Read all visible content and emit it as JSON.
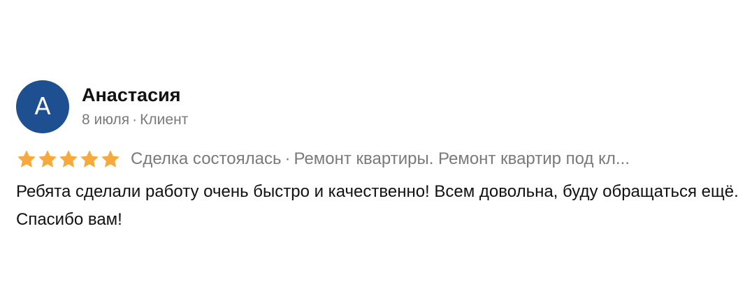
{
  "review": {
    "avatar_letter": "А",
    "avatar_color": "#1d4f91",
    "author_name": "Анастасия",
    "date": "8 июля",
    "separator": "·",
    "role": "Клиент",
    "rating": 5,
    "rating_max": 5,
    "star_color": "#f7a93b",
    "star_icon": "star-icon",
    "deal_status": "Сделка состоялась",
    "service": "Ремонт квартиры. Ремонт квартир под кл...",
    "text": "Ребята сделали работу очень быстро и качественно! Всем довольна, буду обращаться ещё. Спасибо вам!"
  }
}
